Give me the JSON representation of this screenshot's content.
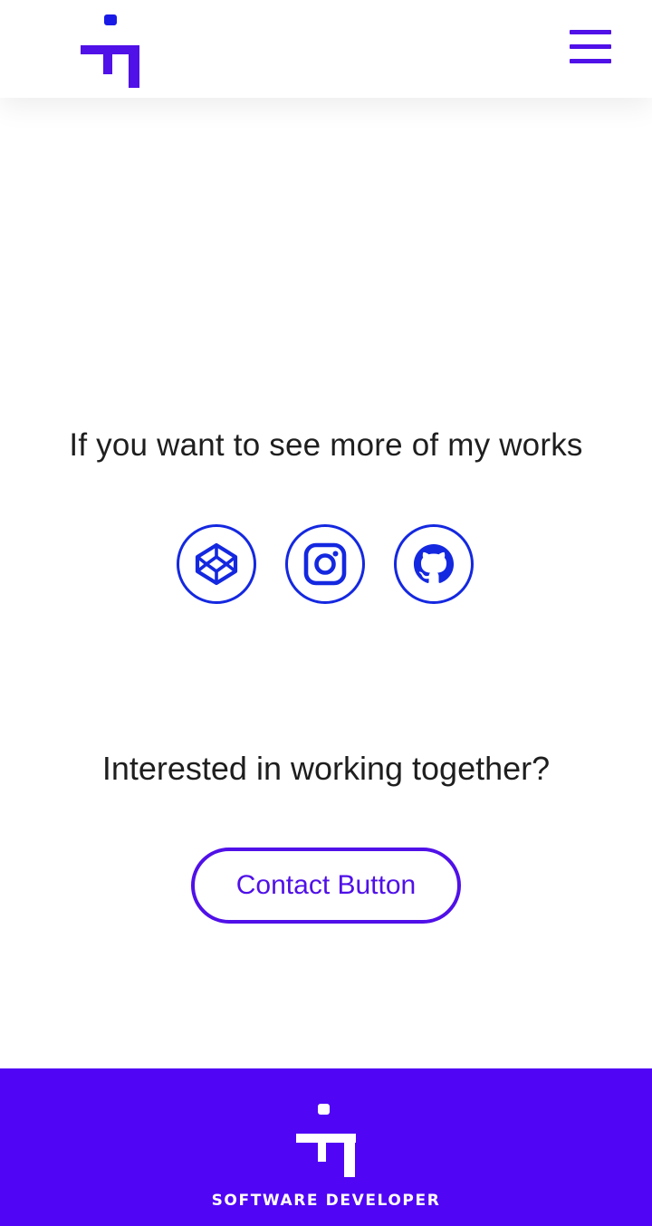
{
  "colors": {
    "brand_purple": "#5010e8",
    "icon_blue": "#1428e0",
    "logo_dot_blue": "#1a1ae6",
    "text_dark": "#1e1e1e",
    "footer_bg": "#5005f5",
    "white": "#ffffff"
  },
  "header": {
    "logo_icon": "brand-logo-icon",
    "menu_icon": "hamburger-menu-icon"
  },
  "works": {
    "heading": "If you want to see more of my works",
    "links": [
      {
        "icon": "codepen-icon"
      },
      {
        "icon": "instagram-icon"
      },
      {
        "icon": "github-icon"
      }
    ]
  },
  "contact": {
    "heading": "Interested in working together?",
    "button_label": "Contact Button"
  },
  "footer": {
    "logo_icon": "brand-logo-icon",
    "tagline": "SOFTWARE DEVELOPER"
  }
}
